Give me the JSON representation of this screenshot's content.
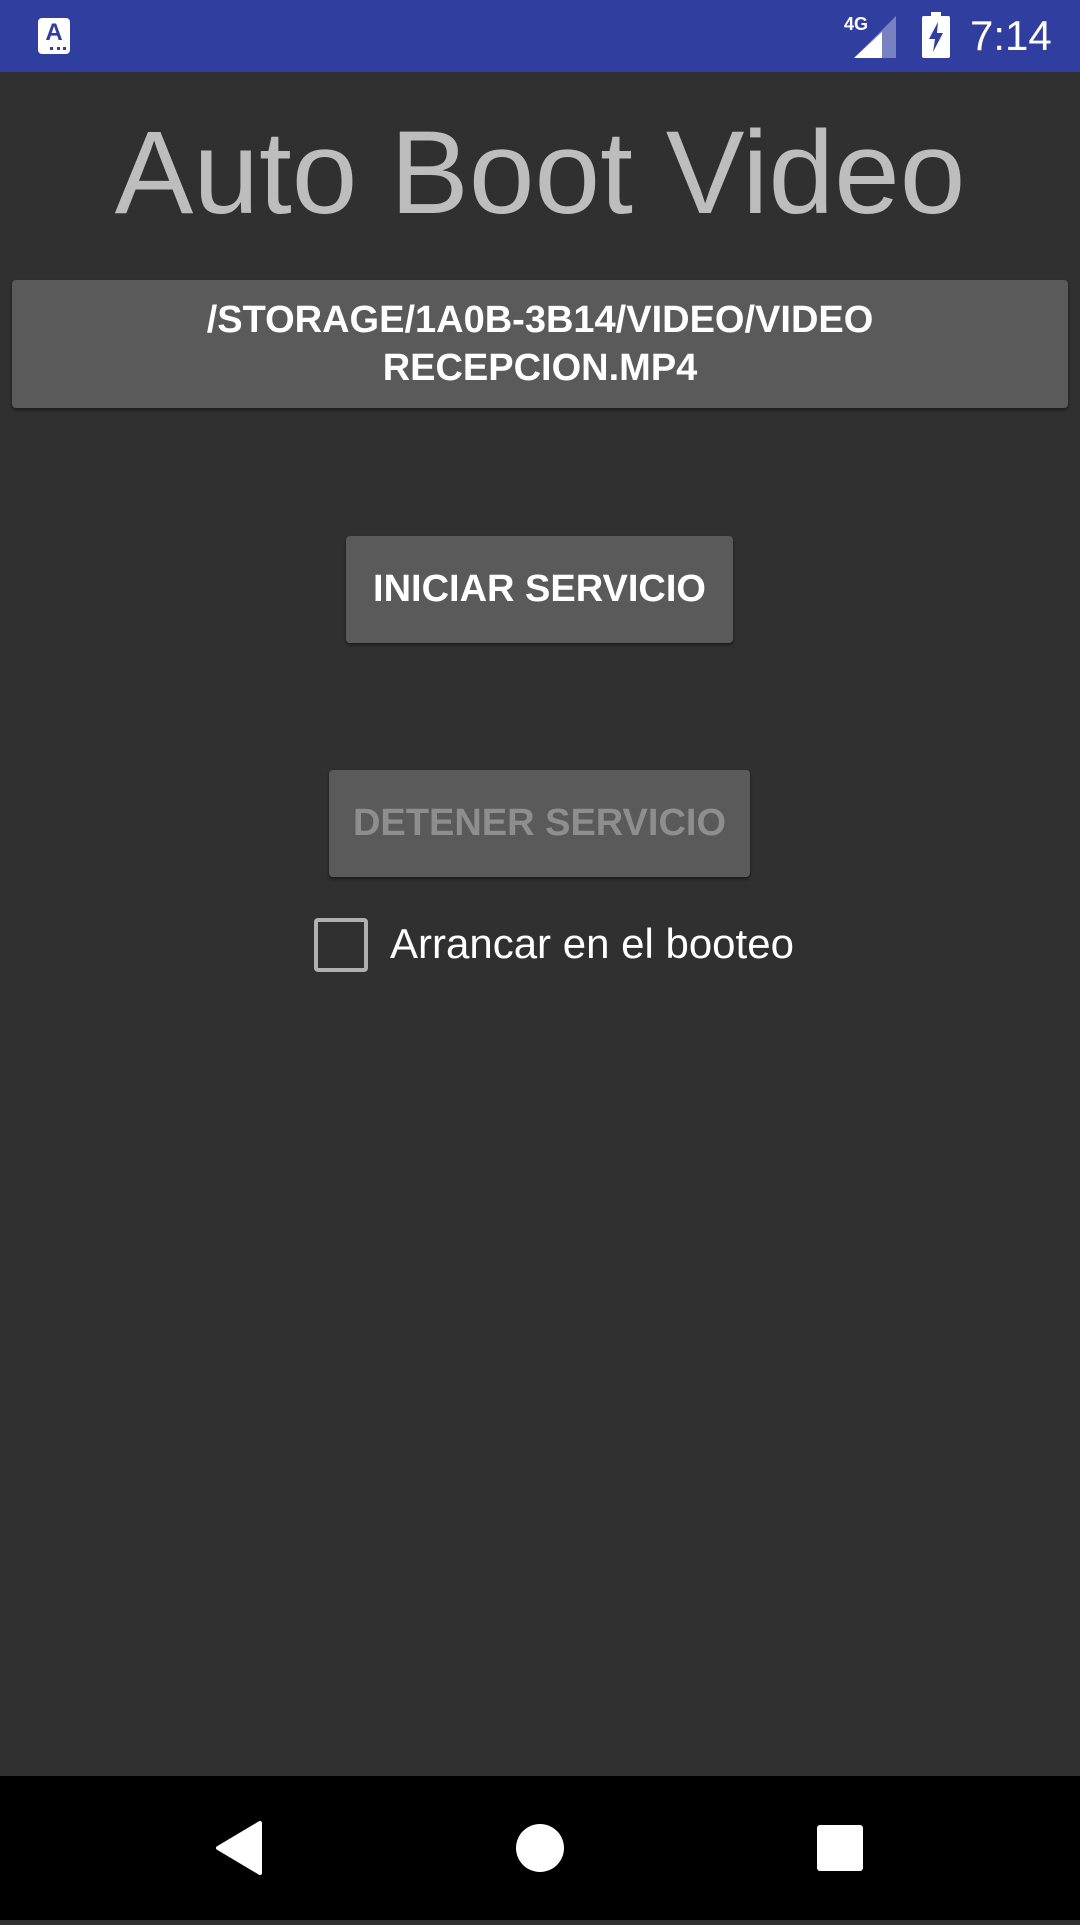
{
  "status_bar": {
    "network": "4G",
    "time": "7:14",
    "background_color": "#303F9F",
    "icons": [
      "app-notification-icon",
      "cell-signal-icon",
      "battery-charging-icon"
    ]
  },
  "app": {
    "title": "Auto Boot Video",
    "file_path_button": "/STORAGE/1A0B-3B14/VIDEO/VIDEO RECEPCION.MP4",
    "start_button": "INICIAR SERVICIO",
    "stop_button": "DETENER SERVICIO",
    "stop_button_enabled": false,
    "boot_checkbox": {
      "label": "Arrancar en el booteo",
      "checked": false
    }
  },
  "nav_bar": {
    "icons": [
      "back-icon",
      "home-icon",
      "recents-icon"
    ]
  }
}
